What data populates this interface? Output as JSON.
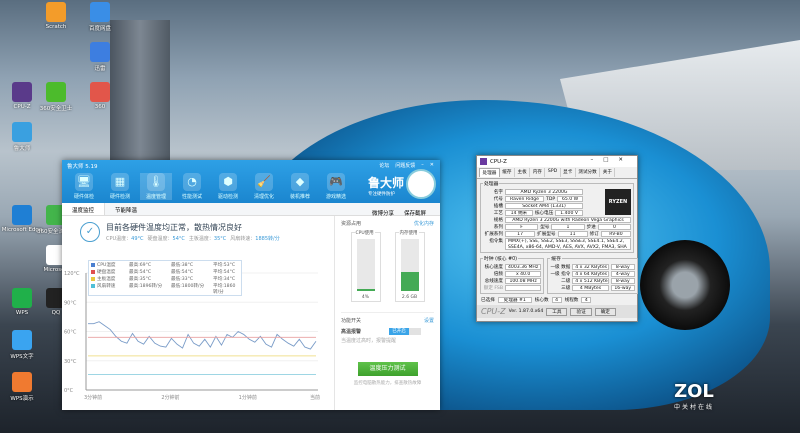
{
  "desktop": {
    "icons": [
      {
        "label": "Scratch",
        "color": "#f39c2a"
      },
      {
        "label": "百度网盘",
        "color": "#3a8ee6"
      },
      {
        "label": "迅雷",
        "color": "#3d7ee0"
      },
      {
        "label": "CPU-Z",
        "color": "#5a3a8a"
      },
      {
        "label": "360安全卫士",
        "color": "#4cbb2c"
      },
      {
        "label": "360",
        "color": "#e2564a"
      },
      {
        "label": "鲁大师",
        "color": "#3aa0e0"
      },
      {
        "label": "Microsoft Edge",
        "color": "#1f7fd4"
      },
      {
        "label": "360安全浏览器",
        "color": "#43b54b"
      },
      {
        "label": "Microsoft",
        "color": "#ffffff"
      },
      {
        "label": "WPS",
        "color": "#20b04a"
      },
      {
        "label": "QQ",
        "color": "#222222"
      },
      {
        "label": "WPS文字",
        "color": "#3aa4f0"
      },
      {
        "label": "WPS演示",
        "color": "#f07a30"
      }
    ]
  },
  "ludashi": {
    "title": "鲁大师 5.19",
    "top_links": [
      "论坛",
      "问题反馈"
    ],
    "tools": [
      {
        "label": "硬件体检",
        "icon": "monitor-icon"
      },
      {
        "label": "硬件检测",
        "icon": "chip-icon"
      },
      {
        "label": "温度管理",
        "icon": "thermometer-icon"
      },
      {
        "label": "性能测试",
        "icon": "gauge-icon"
      },
      {
        "label": "驱动检测",
        "icon": "driver-icon"
      },
      {
        "label": "清理优化",
        "icon": "broom-icon"
      },
      {
        "label": "装机推荐",
        "icon": "cube-icon"
      },
      {
        "label": "游戏精选",
        "icon": "gamepad-icon"
      }
    ],
    "brand": "鲁大师",
    "slogan": "专注硬件防护",
    "tabs": [
      "温度监控",
      "节能降温"
    ],
    "share": "微博分享",
    "save": "保存截屏",
    "status_title": "目前各硬件温度均正常，散热情况良好",
    "readings": [
      {
        "label": "CPU温度：",
        "value": "49°C"
      },
      {
        "label": "硬盘温度：",
        "value": "54°C"
      },
      {
        "label": "主板温度：",
        "value": "35°C"
      },
      {
        "label": "风扇转速：",
        "value": "1885转/分"
      }
    ],
    "legend": [
      {
        "name": "CPU温度",
        "max": "最高:69°C",
        "min": "最低:38°C",
        "avg": "平均:53°C",
        "color": "#4a7fd0"
      },
      {
        "name": "硬盘温度",
        "max": "最高:54°C",
        "min": "最低:54°C",
        "avg": "平均:54°C",
        "color": "#e05050"
      },
      {
        "name": "主板温度",
        "max": "最高:35°C",
        "min": "最低:33°C",
        "avg": "平均:34°C",
        "color": "#e8c840"
      },
      {
        "name": "风扇转速",
        "max": "最高:1896转/分",
        "min": "最低:1800转/分",
        "avg": "平均:1860转/分",
        "color": "#50c0d8"
      }
    ],
    "side": {
      "title": "资源占用",
      "optimize": "优化内存",
      "cpu_label": "CPU使用",
      "cpu_value": "4%",
      "cpu_fraction": 0.04,
      "mem_label": "内存使用",
      "mem_value": "2.6 GB",
      "mem_fraction": 0.35,
      "func_title": "功能开关",
      "settings": "设置",
      "alarm": "高温报警",
      "alarm_state": "已开启",
      "alarm_desc": "当温度过高时，报警提醒",
      "stress_btn": "温度压力测试",
      "stress_desc": "监控电脑散热能力，排查散热故障"
    }
  },
  "chart_data": {
    "type": "line",
    "ylim": [
      0,
      120
    ],
    "yticks": [
      "0°C",
      "30°C",
      "60°C",
      "90°C",
      "120°C"
    ],
    "ytick_values": [
      0,
      30,
      60,
      90,
      120
    ],
    "xticks": [
      "3分钟前",
      "2分钟前",
      "1分钟前",
      "当前"
    ],
    "series": [
      {
        "name": "CPU温度",
        "color": "#7a9cc8",
        "values": [
          68,
          68,
          70,
          66,
          62,
          55,
          50,
          48,
          58,
          50,
          47,
          55,
          48,
          45,
          44,
          53,
          47,
          43,
          57,
          48,
          45,
          52,
          44,
          55,
          46,
          57,
          54,
          60,
          57,
          52,
          49,
          55,
          47,
          44,
          57,
          52,
          48,
          45,
          52,
          44,
          42,
          50
        ]
      },
      {
        "name": "硬盘温度",
        "color": "#e8a0a0",
        "values": [
          54,
          54
        ]
      },
      {
        "name": "主板温度",
        "color": "#f0e090",
        "values": [
          35,
          35
        ]
      },
      {
        "name": "风扇转速",
        "color": "#90d0e0",
        "values": [
          16,
          16
        ]
      }
    ]
  },
  "cpuz": {
    "title": "CPU-Z",
    "tabs": [
      "处理器",
      "缓存",
      "主板",
      "内存",
      "SPD",
      "显卡",
      "测试分数",
      "关于"
    ],
    "processor_legend": "处理器",
    "name_label": "名字",
    "name": "AMD Ryzen 3 2200G",
    "code_label": "代号",
    "code": "Raven Ridge",
    "tdp_label": "TDP",
    "tdp": "65.0 W",
    "socket_label": "插槽",
    "socket": "Socket AM4 (1331)",
    "tech_label": "工艺",
    "tech": "14 纳米",
    "volt_label": "核心电压",
    "volt": "1.400 V",
    "spec_label": "规格",
    "spec": "AMD Ryzen 3 2200G with Radeon Vega Graphics",
    "family_label": "系列",
    "family": "F",
    "model_label": "型号",
    "model": "1",
    "step_label": "步进",
    "step": "0",
    "extfam_label": "扩展系列",
    "extfam": "17",
    "extmod_label": "扩展型号",
    "extmod": "11",
    "rev_label": "修订",
    "rev": "RV-B0",
    "inst_label": "指令集",
    "inst": "MMX(+), SSE, SSE2, SSE3, SSSE3, SSE4.1, SSE4.2, SSE4A, x86-64, AMD-V, AES, AVX, AVX2, FMA3, SHA",
    "clock_legend": "时钟 (核心 #0)",
    "core_speed_label": "核心速度",
    "core_speed": "4003.36 MHz",
    "mult_label": "倍频",
    "mult": "x 40.0",
    "bus_label": "总线速度",
    "bus": "100.08 MHz",
    "fsb_label": "额定 FSB",
    "cache_legend": "缓存",
    "cache": [
      {
        "label": "一级 数据",
        "size": "4 x 32 KBytes",
        "way": "8-way"
      },
      {
        "label": "一级 指令",
        "size": "4 x 64 KBytes",
        "way": "4-way"
      },
      {
        "label": "二级",
        "size": "4 x 512 KBytes",
        "way": "8-way"
      },
      {
        "label": "三级",
        "size": "4 MBytes",
        "way": "16-way"
      }
    ],
    "selected_label": "已选择",
    "selected": "处理器 #1",
    "cores_label": "核心数",
    "cores": "4",
    "threads_label": "线程数",
    "threads": "4",
    "version": "Ver. 1.87.0.x64",
    "tools_btn": "工具",
    "validate_btn": "验证",
    "ok_btn": "确定",
    "logo": "RYZEN"
  },
  "watermark": {
    "brand": "ZOL",
    "sub": "中关村在线"
  }
}
